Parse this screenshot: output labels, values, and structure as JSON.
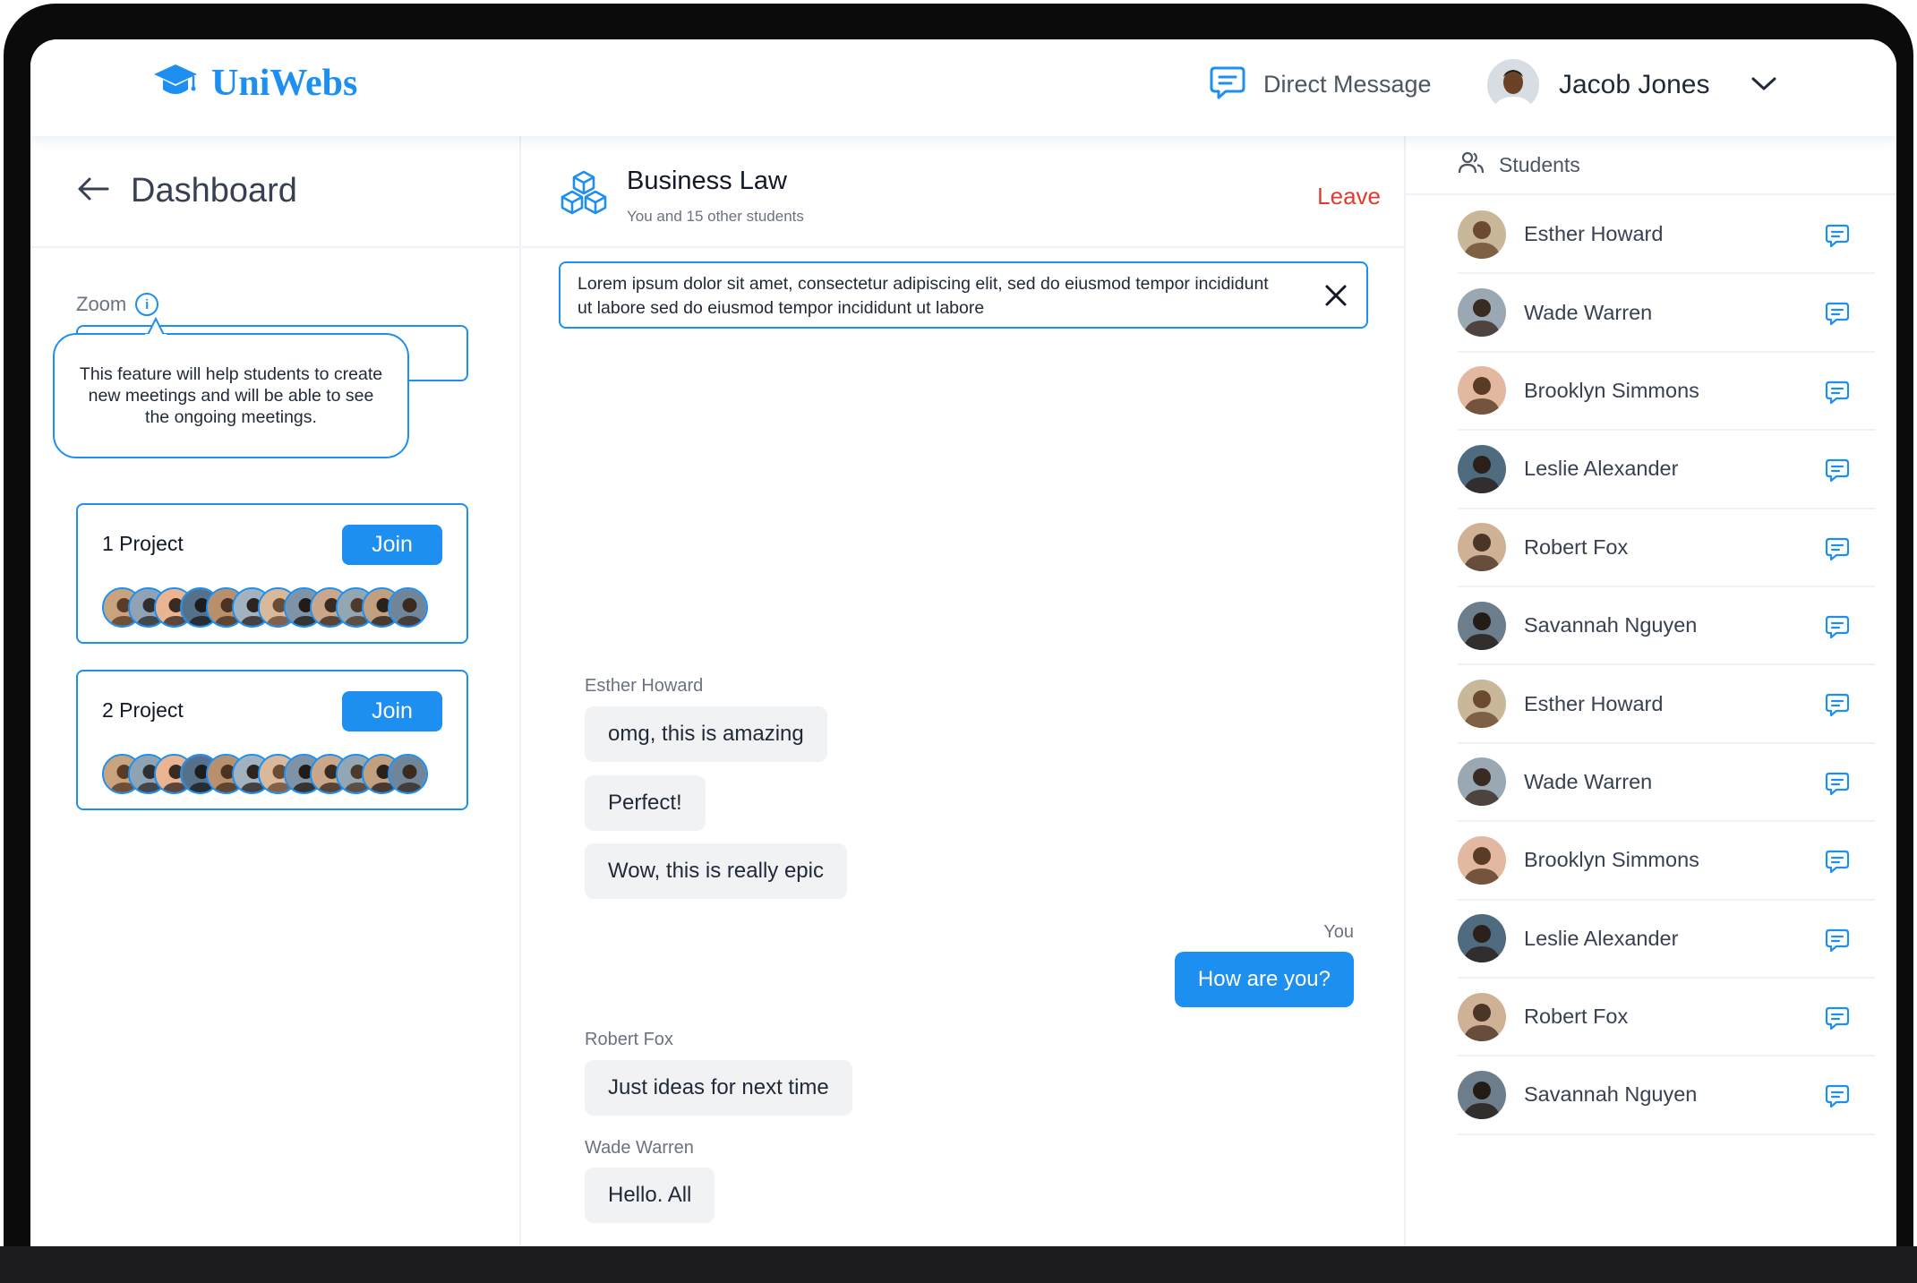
{
  "header": {
    "logo_text": "UniWebs",
    "direct_message_label": "Direct Message",
    "user_name": "Jacob Jones"
  },
  "left": {
    "back_label": "Dashboard",
    "zoom_label": "Zoom",
    "tooltip_text": "This feature will help students to create new meetings and will be able to see the ongoing meetings.",
    "projects": [
      {
        "title": "1 Project",
        "join_label": "Join"
      },
      {
        "title": "2 Project",
        "join_label": "Join"
      }
    ]
  },
  "chat": {
    "title": "Business Law",
    "subtitle": "You and 15 other students",
    "leave_label": "Leave",
    "notice_text": "Lorem ipsum dolor sit amet, consectetur adipiscing elit, sed do eiusmod tempor incididunt ut labore sed do eiusmod tempor incididunt ut labore",
    "messages": [
      {
        "sender": "Esther Howard",
        "texts": [
          "omg, this is amazing",
          "Perfect!",
          "Wow, this is really epic"
        ]
      },
      {
        "sender": "You",
        "texts": [
          "How are you?"
        ]
      },
      {
        "sender": "Robert Fox",
        "texts": [
          "Just ideas for next time"
        ]
      },
      {
        "sender": "Wade Warren",
        "texts": [
          "Hello. All"
        ]
      }
    ]
  },
  "students": {
    "title": "Students",
    "list": [
      {
        "name": "Esther Howard"
      },
      {
        "name": "Wade Warren"
      },
      {
        "name": "Brooklyn Simmons"
      },
      {
        "name": "Leslie Alexander"
      },
      {
        "name": "Robert Fox"
      },
      {
        "name": "Savannah Nguyen"
      },
      {
        "name": "Esther Howard"
      },
      {
        "name": "Wade Warren"
      },
      {
        "name": "Brooklyn Simmons"
      },
      {
        "name": "Leslie Alexander"
      },
      {
        "name": "Robert Fox"
      },
      {
        "name": "Savannah Nguyen"
      }
    ]
  },
  "colors": {
    "accent": "#1d8ff0",
    "leave": "#e23b2e",
    "bubble_bg": "#f1f2f4"
  }
}
